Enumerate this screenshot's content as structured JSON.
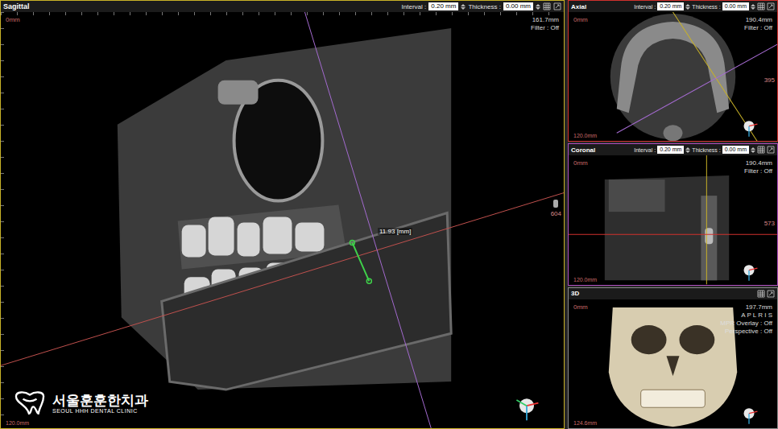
{
  "panels": [
    {
      "kind": "sagittal",
      "title": "Sagittal",
      "color": "#c9b227",
      "interval": {
        "label": "Interval :",
        "value": "0.20 mm"
      },
      "thickness": {
        "label": "Thickness :",
        "value": "0.00 mm"
      },
      "origin": "0mm",
      "extent": "161.7mm",
      "depth": "120.0mm",
      "info": [
        "Filter : Off"
      ],
      "slice": "604"
    },
    {
      "kind": "axial",
      "title": "Axial",
      "color": "#d0312d",
      "interval": {
        "label": "Interval :",
        "value": "0.20 mm"
      },
      "thickness": {
        "label": "Thickness :",
        "value": "0.00 mm"
      },
      "origin": "0mm",
      "extent": "190.4mm",
      "depth": "120.0mm",
      "info": [
        "Filter : Off"
      ],
      "slice": "395"
    },
    {
      "kind": "coronal",
      "title": "Coronal",
      "color": "#b04fc0",
      "interval": {
        "label": "Interval :",
        "value": "0.20 mm"
      },
      "thickness": {
        "label": "Thickness :",
        "value": "0.00 mm"
      },
      "origin": "0mm",
      "extent": "190.4mm",
      "depth": "120.0mm",
      "info": [
        "Filter : Off"
      ],
      "slice": "573"
    },
    {
      "kind": "3d",
      "title": "3D",
      "color": "#8a8a8a",
      "origin": "0mm",
      "extent": "197.7mm",
      "depth": "124.6mm",
      "info": [
        "A P L R I S",
        "MPR Overlay : Off",
        "Perspective : Off"
      ]
    }
  ],
  "measurement": {
    "value": "11.93 [mm]"
  },
  "logo": {
    "name": "서울훈훈한치과",
    "subtitle": "SEOUL HHH DENTAL CLINIC"
  }
}
